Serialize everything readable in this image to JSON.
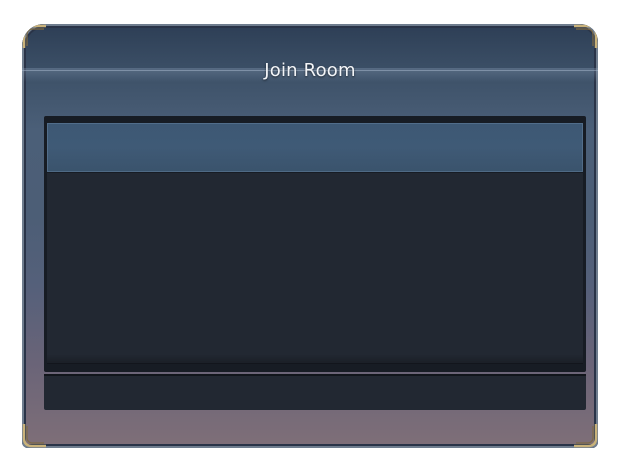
{
  "dialog": {
    "title": "Join Room"
  },
  "room_list": {
    "rows": []
  },
  "input": {
    "value": ""
  },
  "colors": {
    "panel_top": "#2d3e55",
    "panel_bottom": "#7f6f78",
    "list_bg": "#222832",
    "selected_row": "#3f5a76",
    "title_text": "#f3f5f8",
    "ornament": "#c9b27a"
  },
  "icons": {
    "corner": "corner-ornament-icon"
  }
}
